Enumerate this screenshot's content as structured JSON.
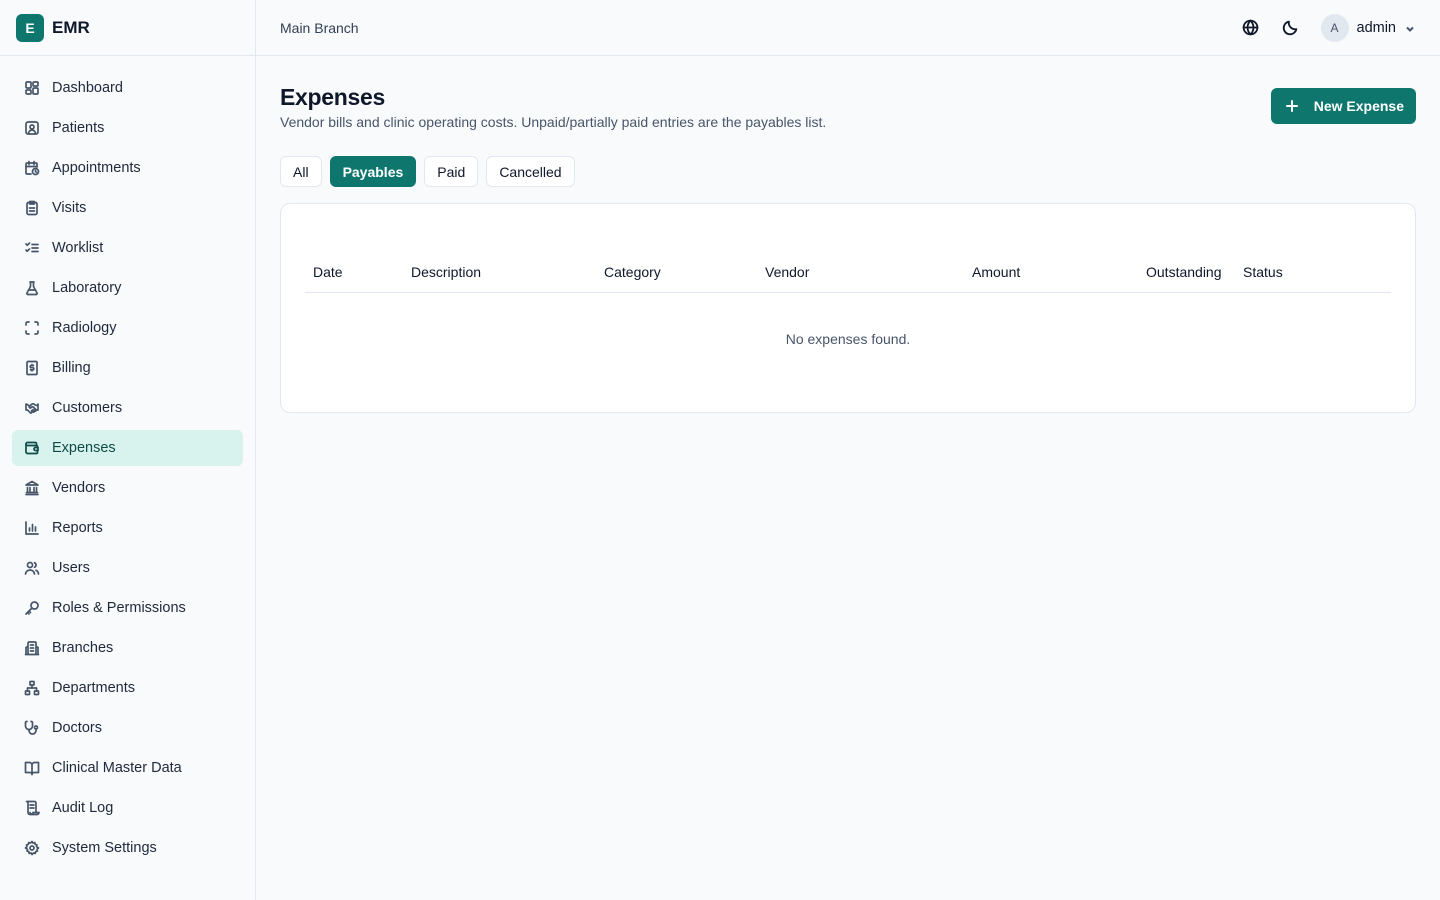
{
  "brand": {
    "letter": "E",
    "name": "EMR"
  },
  "sidebar": {
    "items": [
      {
        "label": "Dashboard",
        "icon": "dashboard-icon"
      },
      {
        "label": "Patients",
        "icon": "patients-icon"
      },
      {
        "label": "Appointments",
        "icon": "calendar-clock-icon"
      },
      {
        "label": "Visits",
        "icon": "clipboard-icon"
      },
      {
        "label": "Worklist",
        "icon": "list-checks-icon"
      },
      {
        "label": "Laboratory",
        "icon": "flask-icon"
      },
      {
        "label": "Radiology",
        "icon": "scan-icon"
      },
      {
        "label": "Billing",
        "icon": "receipt-dollar-icon"
      },
      {
        "label": "Customers",
        "icon": "handshake-icon"
      },
      {
        "label": "Expenses",
        "icon": "wallet-icon",
        "active": true
      },
      {
        "label": "Vendors",
        "icon": "landmark-icon"
      },
      {
        "label": "Reports",
        "icon": "bar-chart-icon"
      },
      {
        "label": "Users",
        "icon": "users-icon"
      },
      {
        "label": "Roles & Permissions",
        "icon": "key-icon"
      },
      {
        "label": "Branches",
        "icon": "building-icon"
      },
      {
        "label": "Departments",
        "icon": "network-icon"
      },
      {
        "label": "Doctors",
        "icon": "stethoscope-icon"
      },
      {
        "label": "Clinical Master Data",
        "icon": "book-icon"
      },
      {
        "label": "Audit Log",
        "icon": "scroll-icon"
      },
      {
        "label": "System Settings",
        "icon": "gear-icon"
      }
    ]
  },
  "topbar": {
    "branch": "Main Branch",
    "user_initial": "A",
    "user_name": "admin",
    "icons": [
      "globe-icon",
      "moon-icon",
      "chevron-down-icon"
    ]
  },
  "page": {
    "title": "Expenses",
    "subtitle": "Vendor bills and clinic operating costs. Unpaid/partially paid entries are the payables list.",
    "new_button": "New Expense",
    "tabs": [
      {
        "label": "All",
        "active": false
      },
      {
        "label": "Payables",
        "active": true
      },
      {
        "label": "Paid",
        "active": false
      },
      {
        "label": "Cancelled",
        "active": false
      }
    ],
    "table": {
      "columns": [
        "Date",
        "Description",
        "Category",
        "Vendor",
        "Amount",
        "Outstanding",
        "Status"
      ],
      "empty_message": "No expenses found."
    }
  },
  "colors": {
    "accent": "#0f766e",
    "active_nav_bg": "#d8f2ee",
    "border": "#e2e8f0",
    "bg": "#f8fafc"
  }
}
